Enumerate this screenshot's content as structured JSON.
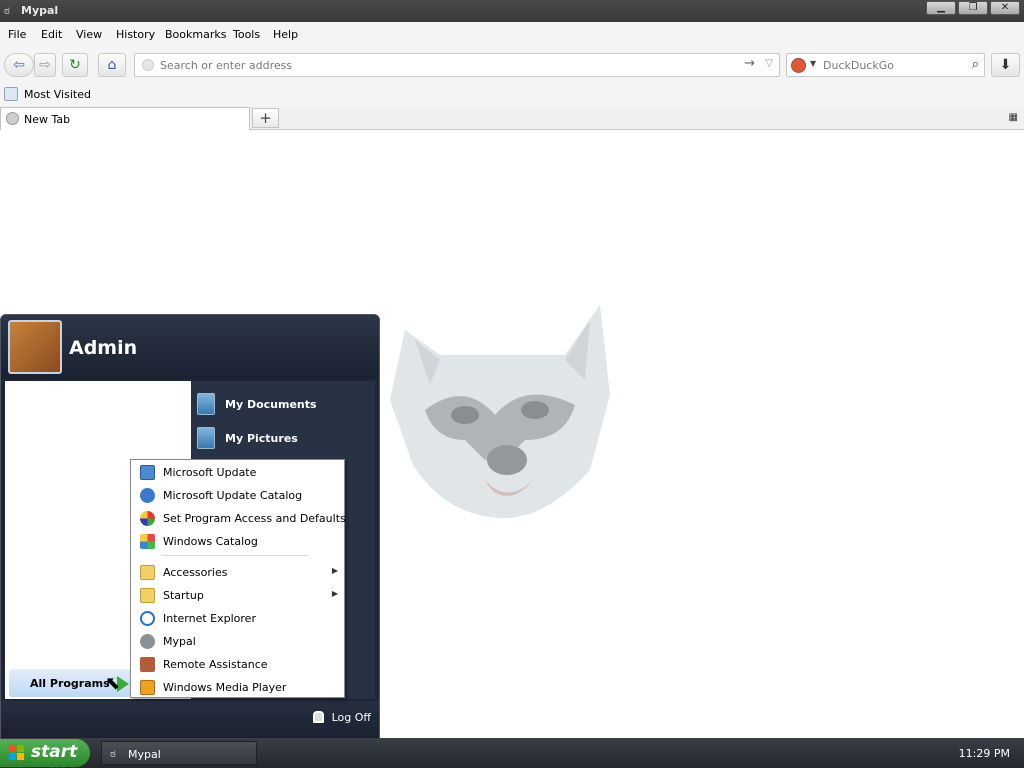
{
  "window": {
    "title": "Mypal",
    "buttons": [
      "▁",
      "❐",
      "✕"
    ]
  },
  "menubar": {
    "items": [
      "File",
      "Edit",
      "View",
      "History",
      "Bookmarks",
      "Tools",
      "Help"
    ]
  },
  "navbar": {
    "url_placeholder": "Search or enter address",
    "search_placeholder": "DuckDuckGo"
  },
  "bookmarks": {
    "items": [
      "Most Visited"
    ]
  },
  "tabs": [
    {
      "label": "New Tab"
    }
  ],
  "start_menu": {
    "user": "Admin",
    "right_items": [
      "My Documents",
      "My Pictures"
    ],
    "all_programs": "All Programs",
    "log_off": "Log Off"
  },
  "programs_menu": {
    "items": [
      {
        "label": "Microsoft Update",
        "icon": "windows-update-icon"
      },
      {
        "label": "Microsoft Update Catalog",
        "icon": "globe-icon"
      },
      {
        "label": "Set Program Access and Defaults",
        "icon": "program-access-icon"
      },
      {
        "label": "Windows Catalog",
        "icon": "windows-catalog-icon"
      },
      {
        "label": "Accessories",
        "icon": "folder-icon",
        "submenu": true
      },
      {
        "label": "Startup",
        "icon": "folder-icon",
        "submenu": true
      },
      {
        "label": "Internet Explorer",
        "icon": "internet-explorer-icon"
      },
      {
        "label": "Mypal",
        "icon": "mypal-icon"
      },
      {
        "label": "Remote Assistance",
        "icon": "remote-assistance-icon"
      },
      {
        "label": "Windows Media Player",
        "icon": "media-player-icon"
      }
    ]
  },
  "taskbar": {
    "start_label": "start",
    "items": [
      {
        "label": "Mypal"
      }
    ],
    "clock": "11:29 PM"
  },
  "colors": {
    "taskbar": "#2b3037",
    "start_button": "#3c9a3c",
    "start_menu": "#1e2736"
  }
}
